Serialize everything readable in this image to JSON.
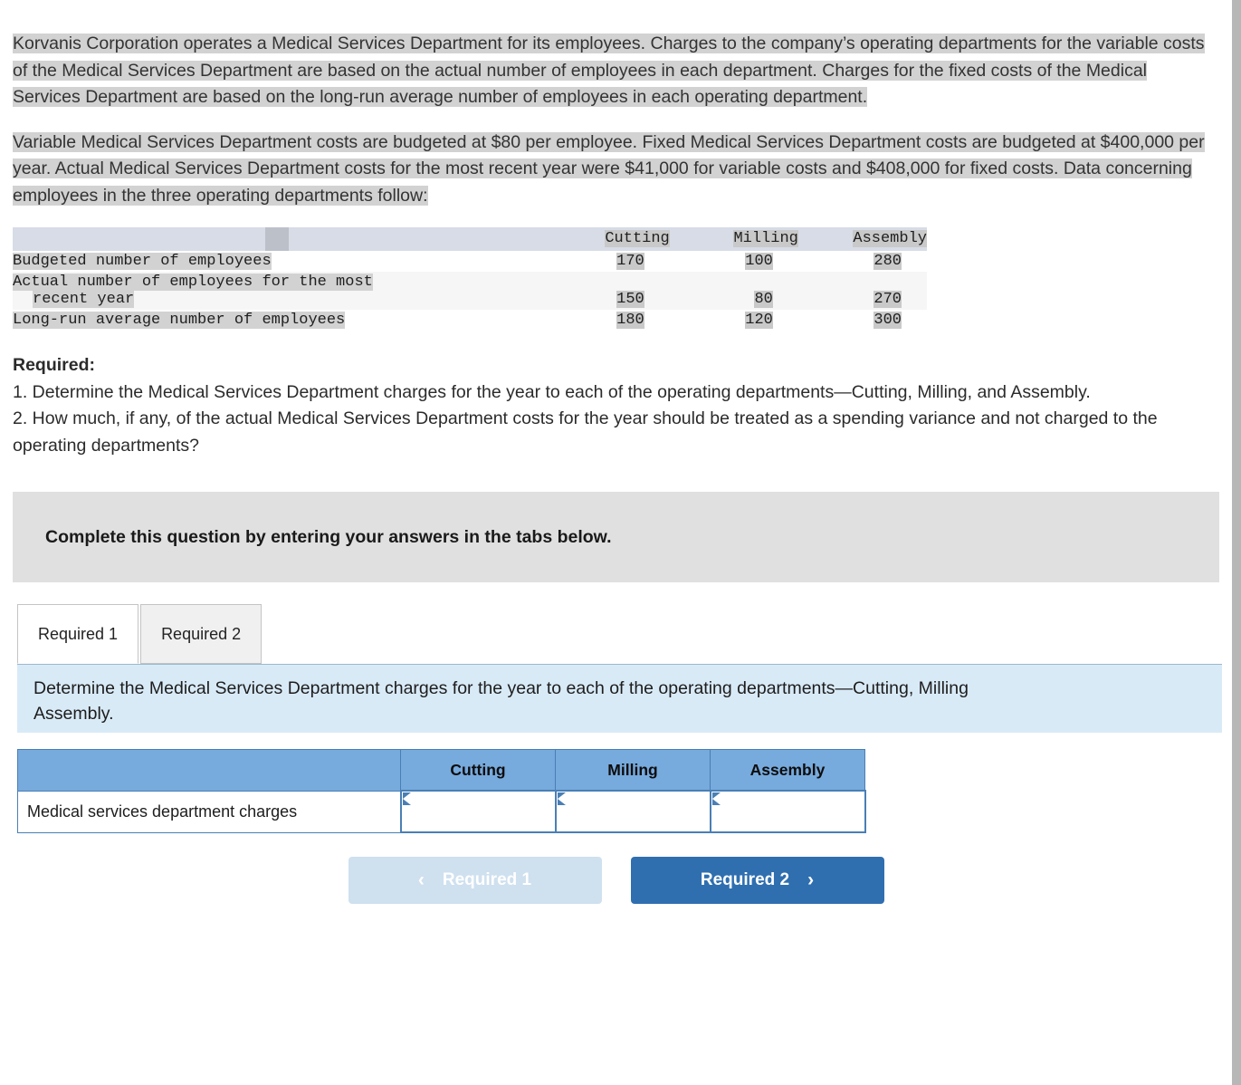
{
  "problem": {
    "paragraph1": "Korvanis Corporation operates a Medical Services Department for its employees. Charges to the company’s operating departments for the variable costs of the Medical Services Department are based on the actual number of employees in each department. Charges for the fixed costs of the Medical Services Department are based on the long-run average number of employees in each operating department.",
    "paragraph2": "Variable Medical Services Department costs are budgeted at $80 per employee. Fixed Medical Services Department costs are budgeted at $400,000 per year. Actual Medical Services Department costs for the most recent year were $41,000 for variable costs and $408,000 for fixed costs. Data concerning employees in the three operating departments follow:"
  },
  "data_table": {
    "stub_header": "",
    "columns": [
      "Cutting",
      "Milling",
      "Assembly"
    ],
    "rows": [
      {
        "label": "Budgeted number of employees",
        "label_line2": "",
        "values": [
          "170",
          "100",
          "280"
        ],
        "shaded": false
      },
      {
        "label": "Actual number of employees for the most",
        "label_line2": "recent year",
        "values": [
          "150",
          "80",
          "270"
        ],
        "shaded": true
      },
      {
        "label": "Long-run average number of employees",
        "label_line2": "",
        "values": [
          "180",
          "120",
          "300"
        ],
        "shaded": false
      }
    ]
  },
  "required": {
    "title": "Required:",
    "item1": "1. Determine the Medical Services Department charges for the year to each of the operating departments—Cutting, Milling, and Assembly.",
    "item2": "2. How much, if any, of the actual Medical Services Department costs for the year should be treated as a spending variance and not charged to the operating departments?"
  },
  "banner": {
    "text": "Complete this question by entering your answers in the tabs below."
  },
  "tabs": [
    {
      "label": "Required 1",
      "active": true
    },
    {
      "label": "Required 2",
      "active": false
    }
  ],
  "instruction": {
    "line1": "Determine the Medical Services Department charges for the year to each of the operating departments—Cutting, Milling",
    "line2": "Assembly."
  },
  "answer_table": {
    "stub_header": "",
    "columns": [
      "Cutting",
      "Milling",
      "Assembly"
    ],
    "row_label": "Medical services department charges",
    "values": [
      "",
      "",
      ""
    ],
    "placeholder": ""
  },
  "nav": {
    "prev_label": "Required 1",
    "prev_chevron": "‹",
    "next_label": "Required 2",
    "next_chevron": "›"
  },
  "colors": {
    "accent_blue": "#2f6fb0",
    "table_header_blue": "#77aadd",
    "instruction_blue": "#d9eaf7",
    "banner_gray": "#e0e0e0",
    "highlight_gray": "#d2d2d2"
  }
}
